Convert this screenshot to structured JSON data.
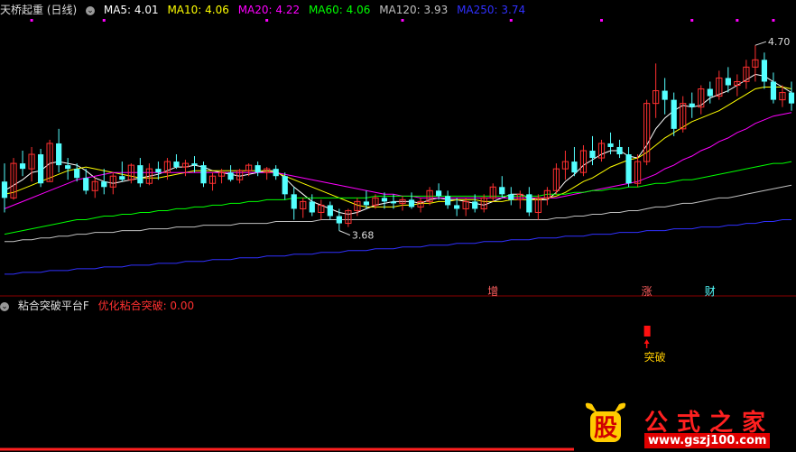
{
  "main_header": {
    "title": "天桥起重 (日线)",
    "ma_items": [
      {
        "label": "MA5: 4.01",
        "color": "#ffffff"
      },
      {
        "label": "MA10: 4.06",
        "color": "#ffff00"
      },
      {
        "label": "MA20: 4.22",
        "color": "#ff00ff"
      },
      {
        "label": "MA60: 4.06",
        "color": "#00ff00"
      },
      {
        "label": "MA120: 3.93",
        "color": "#c0c0c0"
      },
      {
        "label": "MA250: 3.74",
        "color": "#3030ff"
      }
    ]
  },
  "sub_header": {
    "title": "粘合突破平台F",
    "indicator": "优化粘合突破: 0.00",
    "indicator_color": "#ff3030"
  },
  "annotations": {
    "high_label": "4.70",
    "low_label": "3.68",
    "event_markers": [
      "增",
      "涨",
      "财"
    ],
    "signal_label": "突破"
  },
  "watermark": {
    "brand": "公式之家",
    "site": "www.gszj100.com",
    "cap_glyph": "股"
  },
  "chart_data": {
    "type": "candlestick",
    "price_range": [
      3.4,
      4.85
    ],
    "candles": [
      [
        3.95,
        4.05,
        3.78,
        3.86
      ],
      [
        3.86,
        4.08,
        3.85,
        4.05
      ],
      [
        4.05,
        4.12,
        3.98,
        4.02
      ],
      [
        4.02,
        4.14,
        3.95,
        4.1
      ],
      [
        4.1,
        4.13,
        3.92,
        3.94
      ],
      [
        3.95,
        4.18,
        3.95,
        4.16
      ],
      [
        4.16,
        4.24,
        4.0,
        4.04
      ],
      [
        4.04,
        4.08,
        3.96,
        4.02
      ],
      [
        4.02,
        4.05,
        3.95,
        3.97
      ],
      [
        3.97,
        4.02,
        3.88,
        3.9
      ],
      [
        3.9,
        3.97,
        3.86,
        3.95
      ],
      [
        3.95,
        4.02,
        3.88,
        3.92
      ],
      [
        3.92,
        4.0,
        3.88,
        3.98
      ],
      [
        3.98,
        4.06,
        3.95,
        3.96
      ],
      [
        3.96,
        4.05,
        3.94,
        4.04
      ],
      [
        4.04,
        4.08,
        3.92,
        3.94
      ],
      [
        3.94,
        4.05,
        3.93,
        4.02
      ],
      [
        4.02,
        4.06,
        3.96,
        4.0
      ],
      [
        4.0,
        4.08,
        3.96,
        4.06
      ],
      [
        4.06,
        4.1,
        4.02,
        4.03
      ],
      [
        4.03,
        4.07,
        3.98,
        4.05
      ],
      [
        4.05,
        4.09,
        4.0,
        4.04
      ],
      [
        4.04,
        4.06,
        3.92,
        3.94
      ],
      [
        3.94,
        4.0,
        3.9,
        3.98
      ],
      [
        3.98,
        4.02,
        3.94,
        4.0
      ],
      [
        4.0,
        4.04,
        3.95,
        3.96
      ],
      [
        3.96,
        4.02,
        3.94,
        4.01
      ],
      [
        4.01,
        4.05,
        3.98,
        4.04
      ],
      [
        4.04,
        4.06,
        3.98,
        4.0
      ],
      [
        4.0,
        4.03,
        3.96,
        4.02
      ],
      [
        4.02,
        4.04,
        3.96,
        3.98
      ],
      [
        3.98,
        4.0,
        3.85,
        3.88
      ],
      [
        3.88,
        3.92,
        3.74,
        3.8
      ],
      [
        3.8,
        3.86,
        3.75,
        3.84
      ],
      [
        3.84,
        3.88,
        3.76,
        3.78
      ],
      [
        3.78,
        3.85,
        3.74,
        3.82
      ],
      [
        3.82,
        3.84,
        3.74,
        3.76
      ],
      [
        3.76,
        3.8,
        3.68,
        3.72
      ],
      [
        3.72,
        3.8,
        3.7,
        3.79
      ],
      [
        3.79,
        3.86,
        3.76,
        3.84
      ],
      [
        3.84,
        3.9,
        3.8,
        3.82
      ],
      [
        3.82,
        3.88,
        3.8,
        3.86
      ],
      [
        3.86,
        3.89,
        3.8,
        3.84
      ],
      [
        3.84,
        3.88,
        3.8,
        3.83
      ],
      [
        3.83,
        3.87,
        3.79,
        3.85
      ],
      [
        3.85,
        3.89,
        3.8,
        3.81
      ],
      [
        3.81,
        3.86,
        3.78,
        3.84
      ],
      [
        3.84,
        3.92,
        3.82,
        3.9
      ],
      [
        3.9,
        3.94,
        3.85,
        3.87
      ],
      [
        3.87,
        3.9,
        3.8,
        3.82
      ],
      [
        3.82,
        3.86,
        3.76,
        3.8
      ],
      [
        3.8,
        3.86,
        3.76,
        3.84
      ],
      [
        3.84,
        3.88,
        3.78,
        3.8
      ],
      [
        3.8,
        3.88,
        3.78,
        3.86
      ],
      [
        3.86,
        3.94,
        3.84,
        3.92
      ],
      [
        3.92,
        3.98,
        3.86,
        3.88
      ],
      [
        3.88,
        3.92,
        3.82,
        3.85
      ],
      [
        3.85,
        3.9,
        3.8,
        3.88
      ],
      [
        3.88,
        3.92,
        3.76,
        3.78
      ],
      [
        3.78,
        3.88,
        3.74,
        3.86
      ],
      [
        3.86,
        3.92,
        3.82,
        3.9
      ],
      [
        3.9,
        4.05,
        3.88,
        4.02
      ],
      [
        4.02,
        4.12,
        3.96,
        4.06
      ],
      [
        4.06,
        4.14,
        3.98,
        4.0
      ],
      [
        4.0,
        4.15,
        3.98,
        4.12
      ],
      [
        4.12,
        4.2,
        4.04,
        4.08
      ],
      [
        4.08,
        4.18,
        4.06,
        4.16
      ],
      [
        4.16,
        4.22,
        4.1,
        4.14
      ],
      [
        4.14,
        4.18,
        4.08,
        4.1
      ],
      [
        4.1,
        4.14,
        3.92,
        3.94
      ],
      [
        3.94,
        4.1,
        3.92,
        4.06
      ],
      [
        4.06,
        4.4,
        4.04,
        4.38
      ],
      [
        4.38,
        4.6,
        4.3,
        4.45
      ],
      [
        4.45,
        4.52,
        4.32,
        4.4
      ],
      [
        4.4,
        4.44,
        4.2,
        4.24
      ],
      [
        4.24,
        4.42,
        4.22,
        4.38
      ],
      [
        4.38,
        4.44,
        4.3,
        4.36
      ],
      [
        4.36,
        4.48,
        4.32,
        4.46
      ],
      [
        4.46,
        4.5,
        4.38,
        4.42
      ],
      [
        4.42,
        4.56,
        4.4,
        4.52
      ],
      [
        4.52,
        4.58,
        4.44,
        4.48
      ],
      [
        4.48,
        4.54,
        4.42,
        4.5
      ],
      [
        4.5,
        4.62,
        4.46,
        4.58
      ],
      [
        4.58,
        4.7,
        4.5,
        4.62
      ],
      [
        4.62,
        4.66,
        4.46,
        4.5
      ],
      [
        4.5,
        4.55,
        4.38,
        4.4
      ],
      [
        4.4,
        4.48,
        4.36,
        4.44
      ],
      [
        4.44,
        4.5,
        4.34,
        4.38
      ]
    ],
    "ma_series": [
      {
        "name": "MA5",
        "color": "#ffffff",
        "values": [
          3.9,
          3.93,
          3.96,
          4.0,
          4.01,
          4.05,
          4.06,
          4.05,
          4.04,
          4.01,
          3.97,
          3.95,
          3.94,
          3.95,
          3.96,
          3.97,
          3.98,
          3.99,
          4.01,
          4.03,
          4.03,
          4.04,
          4.03,
          4.01,
          4.0,
          3.99,
          3.98,
          3.99,
          4.0,
          4.01,
          4.01,
          3.97,
          3.92,
          3.88,
          3.84,
          3.82,
          3.8,
          3.78,
          3.77,
          3.78,
          3.8,
          3.82,
          3.83,
          3.84,
          3.84,
          3.84,
          3.83,
          3.85,
          3.86,
          3.85,
          3.85,
          3.84,
          3.83,
          3.82,
          3.84,
          3.86,
          3.88,
          3.88,
          3.86,
          3.85,
          3.85,
          3.89,
          3.95,
          3.99,
          4.04,
          4.07,
          4.1,
          4.12,
          4.12,
          4.09,
          4.08,
          4.15,
          4.24,
          4.3,
          4.34,
          4.37,
          4.36,
          4.37,
          4.41,
          4.43,
          4.45,
          4.48,
          4.51,
          4.54,
          4.53,
          4.5,
          4.47,
          4.44
        ]
      },
      {
        "name": "MA10",
        "color": "#ffff00",
        "values": [
          3.88,
          3.89,
          3.91,
          3.93,
          3.95,
          3.97,
          3.99,
          4.01,
          4.02,
          4.03,
          4.02,
          4.01,
          4.0,
          3.99,
          3.98,
          3.97,
          3.97,
          3.97,
          3.98,
          3.99,
          4.0,
          4.01,
          4.01,
          4.01,
          4.01,
          4.01,
          4.01,
          4.01,
          4.01,
          4.01,
          4.0,
          3.98,
          3.96,
          3.94,
          3.92,
          3.9,
          3.88,
          3.86,
          3.84,
          3.82,
          3.81,
          3.81,
          3.81,
          3.81,
          3.82,
          3.82,
          3.83,
          3.83,
          3.84,
          3.84,
          3.85,
          3.85,
          3.85,
          3.84,
          3.84,
          3.84,
          3.85,
          3.85,
          3.85,
          3.85,
          3.86,
          3.87,
          3.89,
          3.92,
          3.95,
          3.97,
          4.0,
          4.03,
          4.05,
          4.07,
          4.08,
          4.11,
          4.15,
          4.19,
          4.22,
          4.25,
          4.28,
          4.3,
          4.32,
          4.34,
          4.37,
          4.4,
          4.43,
          4.46,
          4.47,
          4.47,
          4.47,
          4.46
        ]
      },
      {
        "name": "MA20",
        "color": "#ff00ff",
        "values": [
          3.8,
          3.82,
          3.84,
          3.86,
          3.88,
          3.9,
          3.92,
          3.94,
          3.96,
          3.97,
          3.98,
          3.99,
          4.0,
          4.0,
          4.0,
          4.0,
          4.0,
          4.0,
          4.0,
          4.0,
          4.0,
          4.0,
          4.0,
          4.0,
          4.0,
          4.0,
          4.0,
          4.0,
          4.0,
          4.0,
          4.0,
          3.99,
          3.98,
          3.97,
          3.96,
          3.95,
          3.94,
          3.93,
          3.92,
          3.91,
          3.9,
          3.89,
          3.88,
          3.88,
          3.87,
          3.87,
          3.86,
          3.86,
          3.86,
          3.86,
          3.86,
          3.86,
          3.86,
          3.86,
          3.86,
          3.86,
          3.86,
          3.86,
          3.86,
          3.86,
          3.86,
          3.86,
          3.87,
          3.88,
          3.89,
          3.9,
          3.91,
          3.92,
          3.93,
          3.94,
          3.95,
          3.97,
          3.99,
          4.02,
          4.04,
          4.07,
          4.09,
          4.12,
          4.14,
          4.17,
          4.19,
          4.22,
          4.24,
          4.27,
          4.29,
          4.31,
          4.32,
          4.33
        ]
      },
      {
        "name": "MA60",
        "color": "#00ff00",
        "values": [
          3.66,
          3.67,
          3.68,
          3.69,
          3.7,
          3.71,
          3.72,
          3.73,
          3.74,
          3.74,
          3.75,
          3.76,
          3.76,
          3.77,
          3.77,
          3.78,
          3.78,
          3.79,
          3.79,
          3.8,
          3.8,
          3.81,
          3.81,
          3.82,
          3.82,
          3.83,
          3.83,
          3.84,
          3.84,
          3.85,
          3.85,
          3.85,
          3.86,
          3.86,
          3.86,
          3.86,
          3.86,
          3.86,
          3.86,
          3.86,
          3.86,
          3.87,
          3.87,
          3.87,
          3.87,
          3.87,
          3.87,
          3.87,
          3.87,
          3.87,
          3.87,
          3.87,
          3.87,
          3.87,
          3.87,
          3.87,
          3.87,
          3.87,
          3.87,
          3.87,
          3.88,
          3.88,
          3.88,
          3.89,
          3.89,
          3.9,
          3.9,
          3.91,
          3.91,
          3.92,
          3.92,
          3.93,
          3.94,
          3.94,
          3.95,
          3.96,
          3.96,
          3.97,
          3.98,
          3.99,
          4.0,
          4.01,
          4.02,
          4.03,
          4.04,
          4.05,
          4.05,
          4.06
        ]
      },
      {
        "name": "MA120",
        "color": "#c0c0c0",
        "values": [
          3.62,
          3.62,
          3.63,
          3.63,
          3.64,
          3.64,
          3.65,
          3.65,
          3.66,
          3.66,
          3.67,
          3.67,
          3.67,
          3.68,
          3.68,
          3.68,
          3.69,
          3.69,
          3.69,
          3.7,
          3.7,
          3.7,
          3.71,
          3.71,
          3.71,
          3.71,
          3.72,
          3.72,
          3.72,
          3.72,
          3.73,
          3.73,
          3.73,
          3.73,
          3.73,
          3.74,
          3.74,
          3.74,
          3.74,
          3.74,
          3.74,
          3.74,
          3.74,
          3.74,
          3.74,
          3.74,
          3.74,
          3.74,
          3.74,
          3.74,
          3.74,
          3.74,
          3.74,
          3.74,
          3.74,
          3.74,
          3.74,
          3.74,
          3.74,
          3.74,
          3.74,
          3.75,
          3.75,
          3.76,
          3.76,
          3.77,
          3.77,
          3.78,
          3.78,
          3.79,
          3.79,
          3.8,
          3.81,
          3.81,
          3.82,
          3.83,
          3.83,
          3.84,
          3.85,
          3.86,
          3.86,
          3.87,
          3.88,
          3.89,
          3.9,
          3.91,
          3.92,
          3.93
        ]
      },
      {
        "name": "MA250",
        "color": "#3030ff",
        "values": [
          3.44,
          3.44,
          3.45,
          3.45,
          3.45,
          3.46,
          3.46,
          3.46,
          3.47,
          3.47,
          3.47,
          3.48,
          3.48,
          3.48,
          3.49,
          3.49,
          3.49,
          3.5,
          3.5,
          3.5,
          3.51,
          3.51,
          3.51,
          3.52,
          3.52,
          3.52,
          3.53,
          3.53,
          3.53,
          3.54,
          3.54,
          3.54,
          3.55,
          3.55,
          3.55,
          3.56,
          3.56,
          3.56,
          3.57,
          3.57,
          3.57,
          3.58,
          3.58,
          3.58,
          3.59,
          3.59,
          3.59,
          3.6,
          3.6,
          3.6,
          3.61,
          3.61,
          3.61,
          3.62,
          3.62,
          3.62,
          3.63,
          3.63,
          3.63,
          3.64,
          3.64,
          3.64,
          3.65,
          3.65,
          3.65,
          3.66,
          3.66,
          3.66,
          3.67,
          3.67,
          3.67,
          3.68,
          3.68,
          3.68,
          3.69,
          3.69,
          3.69,
          3.7,
          3.7,
          3.7,
          3.71,
          3.71,
          3.72,
          3.72,
          3.73,
          3.73,
          3.74,
          3.74
        ]
      }
    ],
    "up_color": "#ff3030",
    "down_color": "#54ffff",
    "signal_index": 71,
    "event_indices": [
      54,
      71,
      78
    ],
    "high_index": 83,
    "low_index": 37,
    "marker_dot_indices": [
      3,
      11,
      29,
      44,
      56,
      66,
      76,
      81,
      85
    ]
  }
}
